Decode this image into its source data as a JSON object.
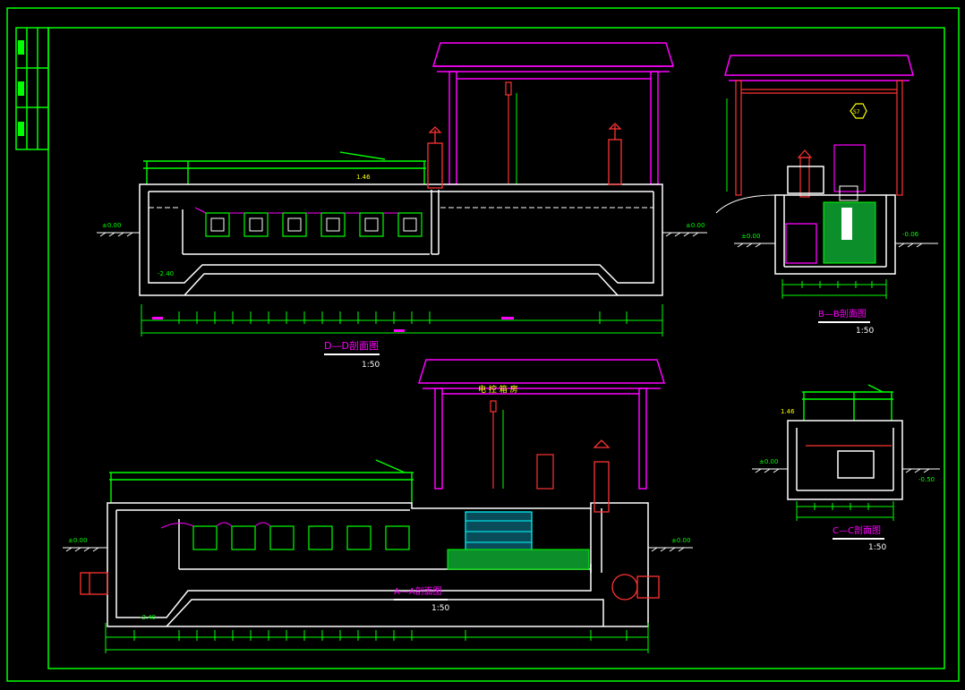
{
  "colors": {
    "background": "#000000",
    "frame": "#00ff00",
    "structure": "#ffffff",
    "roof": "#ff00ff",
    "railing": "#00ff00",
    "columns": "#ff3333",
    "cyan": "#00ffff",
    "yellow": "#ffff00",
    "label": "#ff00ff"
  },
  "sections": {
    "dd": {
      "title": "D—D剖面图",
      "scale": "1:50"
    },
    "bb": {
      "title": "B—B剖面图",
      "scale": "1:50"
    },
    "aa": {
      "title": "A—A剖面图",
      "scale": "1:50"
    },
    "cc": {
      "title": "C—C剖面图",
      "scale": "1:50"
    }
  },
  "annotations": {
    "aa_room": "电 控 箱 房",
    "level_0": "±0.00",
    "level_top": "1.46",
    "level_bottom": "-2.40",
    "level_bb": "-0.06",
    "level_cc": "-0.50",
    "symbol": "S7"
  }
}
